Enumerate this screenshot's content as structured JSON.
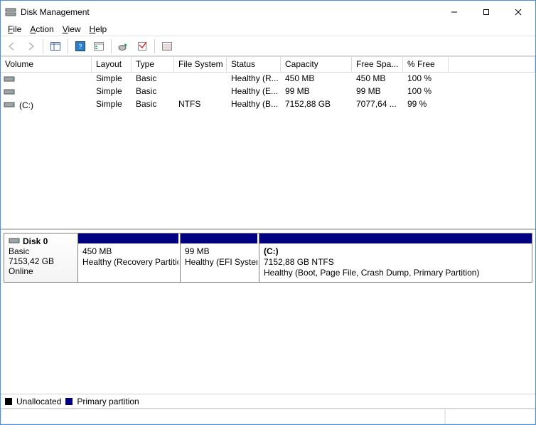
{
  "title": "Disk Management",
  "menus": {
    "file": "File",
    "action": "Action",
    "view": "View",
    "help": "Help"
  },
  "columns": {
    "volume": "Volume",
    "layout": "Layout",
    "type": "Type",
    "fs": "File System",
    "status": "Status",
    "capacity": "Capacity",
    "free": "Free Spa...",
    "pctfree": "% Free"
  },
  "volumes": [
    {
      "name": "",
      "layout": "Simple",
      "type": "Basic",
      "fs": "",
      "status": "Healthy (R...",
      "capacity": "450 MB",
      "free": "450 MB",
      "pctfree": "100 %"
    },
    {
      "name": "",
      "layout": "Simple",
      "type": "Basic",
      "fs": "",
      "status": "Healthy (E...",
      "capacity": "99 MB",
      "free": "99 MB",
      "pctfree": "100 %"
    },
    {
      "name": "(C:)",
      "layout": "Simple",
      "type": "Basic",
      "fs": "NTFS",
      "status": "Healthy (B...",
      "capacity": "7152,88 GB",
      "free": "7077,64 ...",
      "pctfree": "99 %"
    }
  ],
  "disk": {
    "name": "Disk 0",
    "type": "Basic",
    "size": "7153,42 GB",
    "status": "Online",
    "partitions": [
      {
        "title": "",
        "line1": "450 MB",
        "line2": "Healthy (Recovery Partition)"
      },
      {
        "title": "",
        "line1": "99 MB",
        "line2": "Healthy (EFI System Partition)"
      },
      {
        "title": "(C:)",
        "line1": "7152,88 GB NTFS",
        "line2": "Healthy (Boot, Page File, Crash Dump, Primary Partition)"
      }
    ]
  },
  "legend": {
    "unallocated": "Unallocated",
    "primary": "Primary partition"
  }
}
